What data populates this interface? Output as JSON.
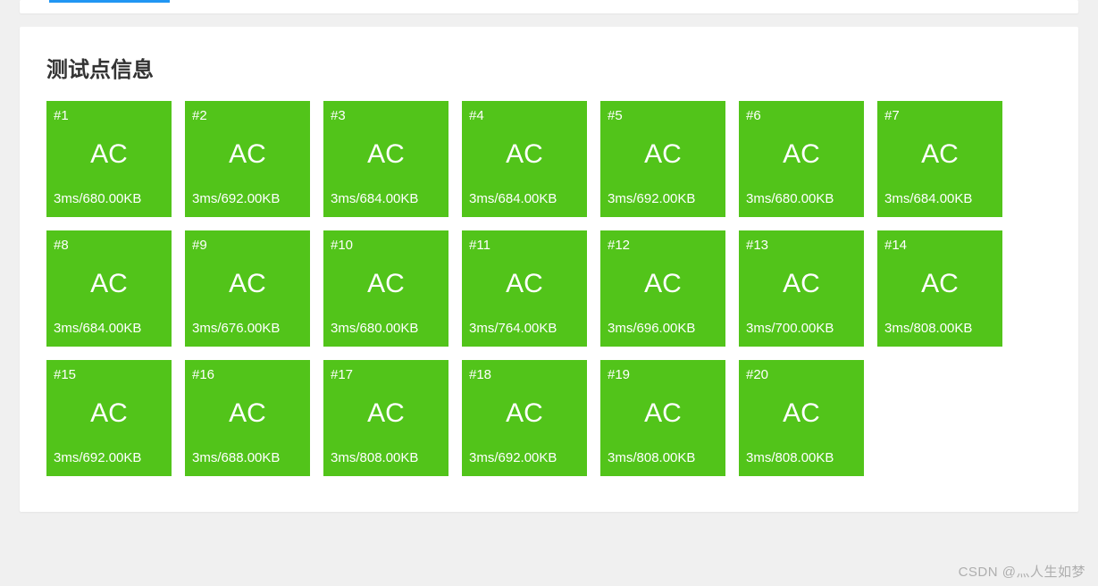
{
  "section_title": "测试点信息",
  "watermark": "CSDN @灬人生如梦",
  "tests": [
    {
      "id": "#1",
      "status": "AC",
      "meta": "3ms/680.00KB"
    },
    {
      "id": "#2",
      "status": "AC",
      "meta": "3ms/692.00KB"
    },
    {
      "id": "#3",
      "status": "AC",
      "meta": "3ms/684.00KB"
    },
    {
      "id": "#4",
      "status": "AC",
      "meta": "3ms/684.00KB"
    },
    {
      "id": "#5",
      "status": "AC",
      "meta": "3ms/692.00KB"
    },
    {
      "id": "#6",
      "status": "AC",
      "meta": "3ms/680.00KB"
    },
    {
      "id": "#7",
      "status": "AC",
      "meta": "3ms/684.00KB"
    },
    {
      "id": "#8",
      "status": "AC",
      "meta": "3ms/684.00KB"
    },
    {
      "id": "#9",
      "status": "AC",
      "meta": "3ms/676.00KB"
    },
    {
      "id": "#10",
      "status": "AC",
      "meta": "3ms/680.00KB"
    },
    {
      "id": "#11",
      "status": "AC",
      "meta": "3ms/764.00KB"
    },
    {
      "id": "#12",
      "status": "AC",
      "meta": "3ms/696.00KB"
    },
    {
      "id": "#13",
      "status": "AC",
      "meta": "3ms/700.00KB"
    },
    {
      "id": "#14",
      "status": "AC",
      "meta": "3ms/808.00KB"
    },
    {
      "id": "#15",
      "status": "AC",
      "meta": "3ms/692.00KB"
    },
    {
      "id": "#16",
      "status": "AC",
      "meta": "3ms/688.00KB"
    },
    {
      "id": "#17",
      "status": "AC",
      "meta": "3ms/808.00KB"
    },
    {
      "id": "#18",
      "status": "AC",
      "meta": "3ms/692.00KB"
    },
    {
      "id": "#19",
      "status": "AC",
      "meta": "3ms/808.00KB"
    },
    {
      "id": "#20",
      "status": "AC",
      "meta": "3ms/808.00KB"
    }
  ]
}
